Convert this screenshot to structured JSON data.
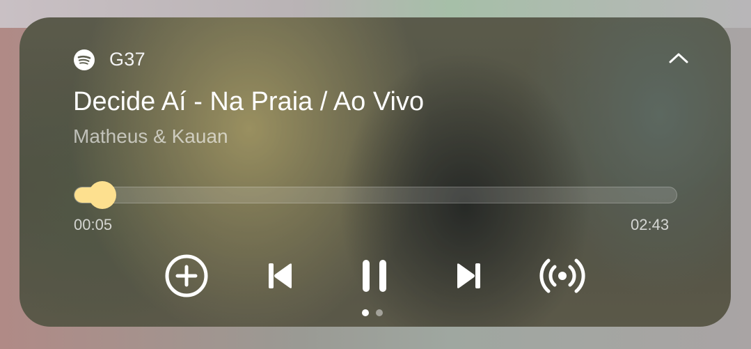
{
  "notification": {
    "app_icon": "spotify-icon",
    "app_name": "G37",
    "collapse_icon": "chevron-up-icon"
  },
  "track": {
    "title": "Decide Aí - Na Praia / Ao Vivo",
    "artist": "Matheus & Kauan"
  },
  "playback": {
    "elapsed": "00:05",
    "duration": "02:43",
    "progress_fraction": 0.034,
    "accent_color": "#fde08f"
  },
  "controls": [
    {
      "name": "add-button",
      "icon": "plus-circle-icon"
    },
    {
      "name": "previous-button",
      "icon": "skip-previous-icon"
    },
    {
      "name": "pause-button",
      "icon": "pause-icon"
    },
    {
      "name": "next-button",
      "icon": "skip-next-icon"
    },
    {
      "name": "broadcast-button",
      "icon": "broadcast-icon"
    }
  ],
  "pager": {
    "pages": 2,
    "active": 1
  }
}
